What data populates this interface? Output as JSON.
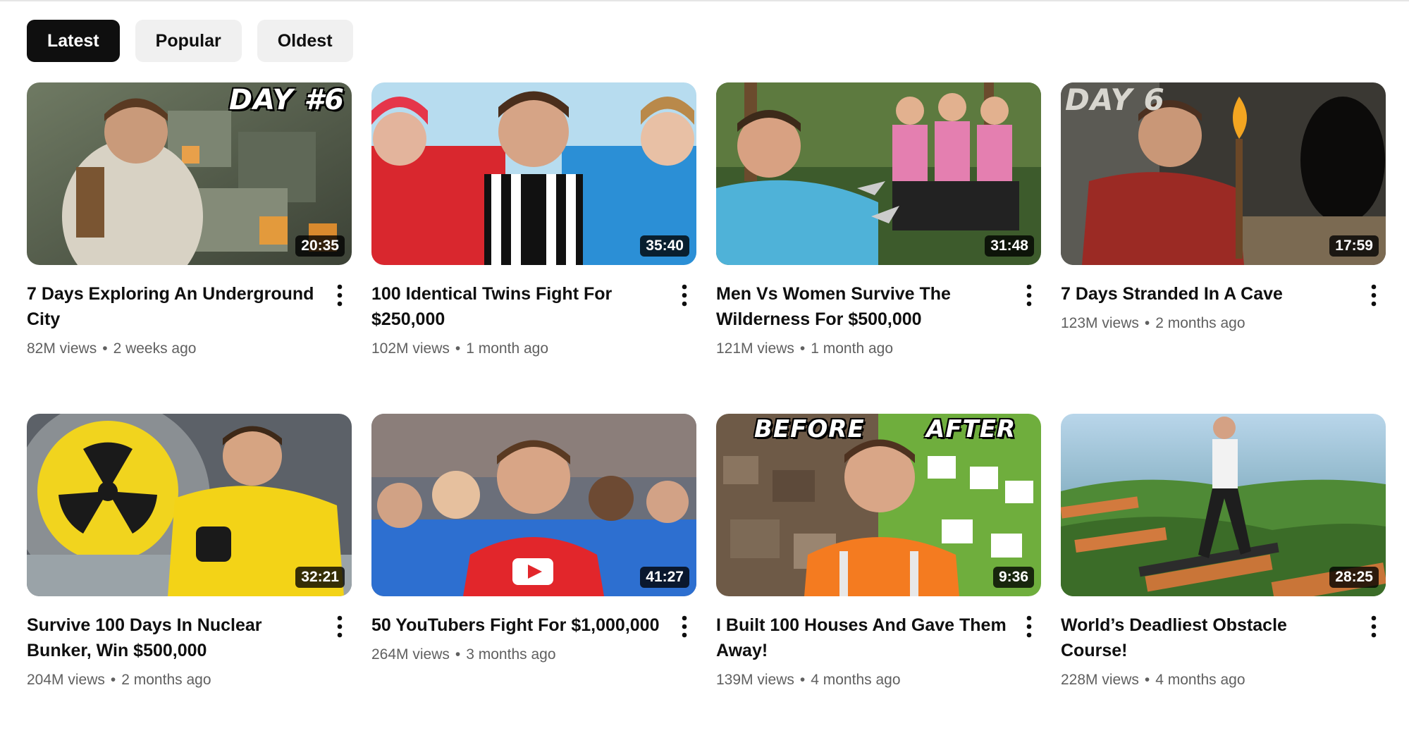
{
  "filters": [
    "Latest",
    "Popular",
    "Oldest"
  ],
  "active_filter": "Latest",
  "videos": [
    {
      "title": "7 Days Exploring An Underground City",
      "views": "82M views",
      "age": "2 weeks ago",
      "duration": "20:35",
      "overlay": "DAY #6"
    },
    {
      "title": "100 Identical Twins Fight For $250,000",
      "views": "102M views",
      "age": "1 month ago",
      "duration": "35:40"
    },
    {
      "title": "Men Vs Women Survive The Wilderness For $500,000",
      "views": "121M views",
      "age": "1 month ago",
      "duration": "31:48"
    },
    {
      "title": "7 Days Stranded In A Cave",
      "views": "123M views",
      "age": "2 months ago",
      "duration": "17:59",
      "overlay": "DAY 6"
    },
    {
      "title": "Survive 100 Days In Nuclear Bunker, Win $500,000",
      "views": "204M views",
      "age": "2 months ago",
      "duration": "32:21"
    },
    {
      "title": "50 YouTubers Fight For $1,000,000",
      "views": "264M views",
      "age": "3 months ago",
      "duration": "41:27"
    },
    {
      "title": "I Built 100 Houses And Gave Them Away!",
      "views": "139M views",
      "age": "4 months ago",
      "duration": "9:36",
      "overlay_left": "BEFORE",
      "overlay_right": "AFTER"
    },
    {
      "title": "World’s Deadliest Obstacle Course!",
      "views": "228M views",
      "age": "4 months ago",
      "duration": "28:25"
    }
  ],
  "separator": "•",
  "icons": {
    "more": "more-vert-icon"
  }
}
